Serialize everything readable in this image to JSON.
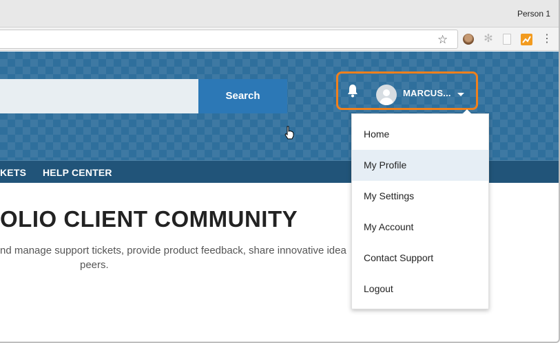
{
  "browser": {
    "profile_name": "Person 1",
    "star_icon": "bookmark-star-icon",
    "menu_icon": "kebab-menu-icon"
  },
  "header": {
    "search_button_label": "Search",
    "user_name": "MARCUS...",
    "accent_color": "#f0801c",
    "brand_color": "#2f6f9c"
  },
  "nav": {
    "items": [
      "KETS",
      "HELP CENTER"
    ]
  },
  "main": {
    "title": "OLIO CLIENT COMMUNITY",
    "description_line1": "nd manage support tickets, provide product feedback, share innovative idea",
    "description_line2": "peers."
  },
  "user_menu": {
    "items": [
      "Home",
      "My Profile",
      "My Settings",
      "My Account",
      "Contact Support",
      "Logout"
    ],
    "active_item": "My Profile"
  }
}
